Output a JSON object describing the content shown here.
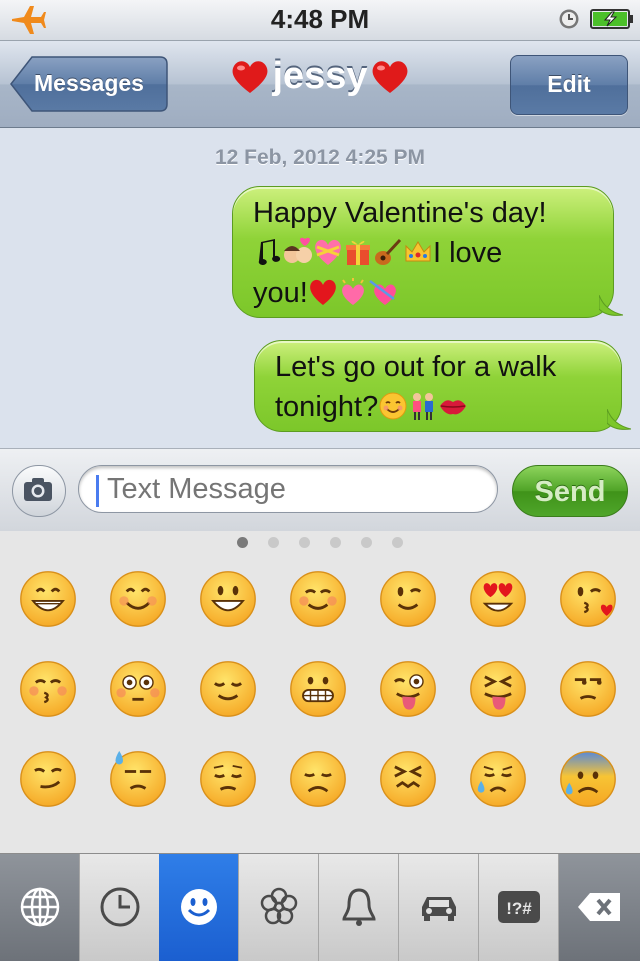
{
  "status_bar": {
    "time": "4:48 PM"
  },
  "nav": {
    "back_label": "Messages",
    "title": "jessy",
    "edit_label": "Edit"
  },
  "thread": {
    "timestamp": "12 Feb, 2012 4:25 PM",
    "messages": [
      {
        "line1": "Happy Valentine's day!",
        "line2_tail": "I love",
        "line3": "you!"
      },
      {
        "line1": "Let's go out for a walk",
        "line2": "tonight?"
      }
    ]
  },
  "compose": {
    "placeholder": "Text Message",
    "send_label": "Send"
  },
  "keyboard": {
    "page_count": 6,
    "active_page": 0,
    "emoji_rows": [
      [
        "grinning",
        "smile",
        "smiley",
        "blush",
        "wink",
        "heart-eyes",
        "kissing-heart"
      ],
      [
        "kissing-closed-eyes",
        "flushed",
        "relieved",
        "grimacing",
        "stuck-out-tongue-winking",
        "stuck-out-tongue-closed-eyes",
        "unamused"
      ],
      [
        "smirk",
        "sweat",
        "pensive",
        "disappointed",
        "confounded",
        "disappointed-relieved",
        "cold-sweat"
      ]
    ],
    "categories": [
      "globe-icon",
      "recent-clock-icon",
      "smiley-icon",
      "flower-icon",
      "bell-icon",
      "car-icon",
      "symbols-icon",
      "delete-icon"
    ],
    "symbols_label": "!?#"
  },
  "colors": {
    "bubble_green": "#8fd338",
    "active_tab": "#2f7ee8",
    "nav_blue": "#9fadc1"
  }
}
